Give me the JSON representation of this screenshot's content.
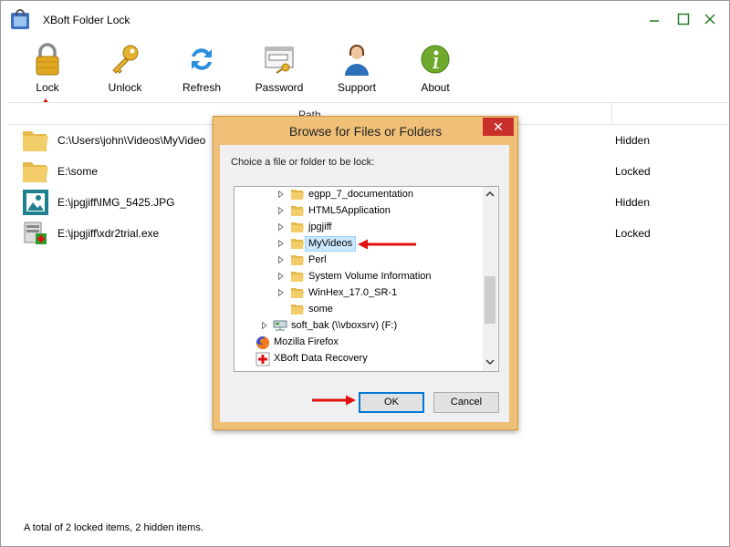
{
  "window": {
    "title": "XBoft Folder Lock"
  },
  "toolbar": {
    "items": [
      {
        "label": "Lock",
        "icon": "padlock-icon"
      },
      {
        "label": "Unlock",
        "icon": "key-icon"
      },
      {
        "label": "Refresh",
        "icon": "refresh-icon"
      },
      {
        "label": "Password",
        "icon": "password-icon"
      },
      {
        "label": "Support",
        "icon": "support-icon"
      },
      {
        "label": "About",
        "icon": "info-icon"
      }
    ]
  },
  "list": {
    "column_path": "Path",
    "rows": [
      {
        "path": "C:\\Users\\john\\Videos\\MyVideo",
        "status": "Hidden",
        "icon": "folder-icon"
      },
      {
        "path": "E:\\some",
        "status": "Locked",
        "icon": "folder-icon"
      },
      {
        "path": "E:\\jpgjiff\\IMG_5425.JPG",
        "status": "Hidden",
        "icon": "image-file-icon"
      },
      {
        "path": "E:\\jpgjiff\\xdr2trial.exe",
        "status": "Locked",
        "icon": "installer-icon"
      }
    ]
  },
  "status": {
    "text": "A total of 2 locked items, 2 hidden items."
  },
  "dialog": {
    "title": "Browse for Files or Folders",
    "prompt": "Choice a file or folder to be lock:",
    "tree": [
      {
        "label": "egpp_7_documentation",
        "icon": "folder-icon",
        "expandable": true
      },
      {
        "label": "HTML5Application",
        "icon": "folder-icon",
        "expandable": true
      },
      {
        "label": "jpgjiff",
        "icon": "folder-icon",
        "expandable": true
      },
      {
        "label": "MyVideos",
        "icon": "folder-icon",
        "expandable": true,
        "selected": true
      },
      {
        "label": "Perl",
        "icon": "folder-icon",
        "expandable": true
      },
      {
        "label": "System Volume Information",
        "icon": "folder-icon",
        "expandable": true
      },
      {
        "label": "WinHex_17.0_SR-1",
        "icon": "folder-icon",
        "expandable": true
      },
      {
        "label": "some",
        "icon": "folder-icon",
        "expandable": false
      },
      {
        "label": "soft_bak (\\\\vboxsrv) (F:)",
        "icon": "network-drive-icon",
        "expandable": true
      },
      {
        "label": "Mozilla Firefox",
        "icon": "firefox-icon",
        "expandable": false
      },
      {
        "label": "XBoft Data Recovery",
        "icon": "recovery-icon",
        "expandable": false
      }
    ],
    "ok_label": "OK",
    "cancel_label": "Cancel"
  },
  "colors": {
    "dialog_frame": "#f0c078",
    "close_button": "#c9302c",
    "annotation_arrow": "#e01010",
    "selection": "#cce8ff"
  }
}
